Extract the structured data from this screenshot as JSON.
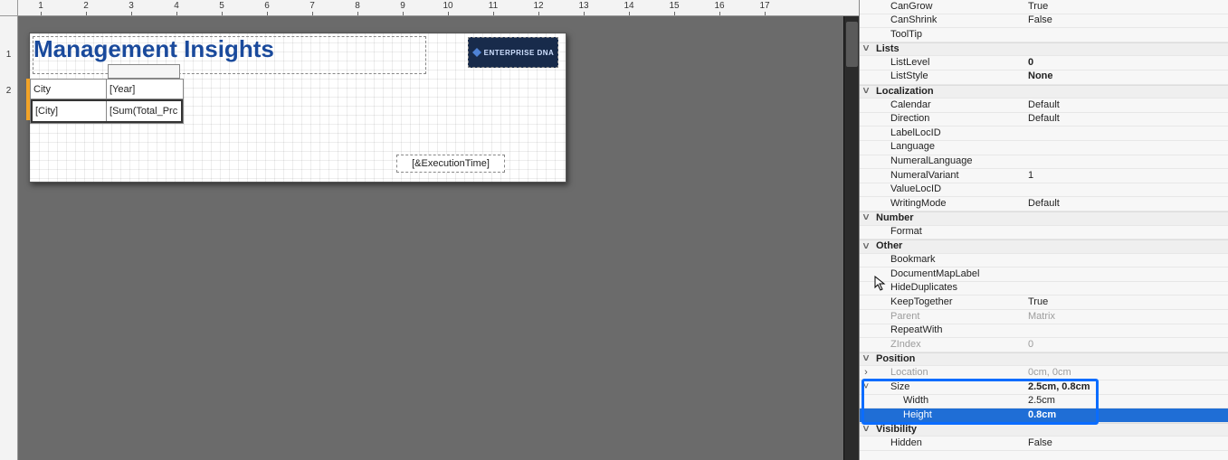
{
  "ruler_top": [
    "1",
    "2",
    "3",
    "4",
    "5",
    "6",
    "7",
    "8",
    "9",
    "10",
    "11",
    "12",
    "13",
    "14",
    "15",
    "16",
    "17"
  ],
  "ruler_left": [
    "1",
    "2"
  ],
  "report": {
    "title": "Management Insights",
    "logo_text": "ENTERPRISE DNA",
    "matrix": {
      "header_row": [
        "City",
        "[Year]"
      ],
      "data_row": [
        "[City]",
        "[Sum(Total_Prc"
      ]
    },
    "execution_time": "[&ExecutionTime]"
  },
  "properties": [
    {
      "type": "row",
      "indent": "indent",
      "key": "CanGrow",
      "value": "True"
    },
    {
      "type": "row",
      "indent": "indent",
      "key": "CanShrink",
      "value": "False"
    },
    {
      "type": "row",
      "indent": "indent",
      "key": "ToolTip",
      "value": ""
    },
    {
      "type": "header",
      "key": "Lists"
    },
    {
      "type": "row",
      "indent": "indent",
      "key": "ListLevel",
      "value": "0",
      "bold": true
    },
    {
      "type": "row",
      "indent": "indent",
      "key": "ListStyle",
      "value": "None",
      "bold": true
    },
    {
      "type": "header",
      "key": "Localization"
    },
    {
      "type": "row",
      "indent": "indent",
      "key": "Calendar",
      "value": "Default"
    },
    {
      "type": "row",
      "indent": "indent",
      "key": "Direction",
      "value": "Default"
    },
    {
      "type": "row",
      "indent": "indent",
      "key": "LabelLocID",
      "value": ""
    },
    {
      "type": "row",
      "indent": "indent",
      "key": "Language",
      "value": ""
    },
    {
      "type": "row",
      "indent": "indent",
      "key": "NumeralLanguage",
      "value": ""
    },
    {
      "type": "row",
      "indent": "indent",
      "key": "NumeralVariant",
      "value": "1"
    },
    {
      "type": "row",
      "indent": "indent",
      "key": "ValueLocID",
      "value": ""
    },
    {
      "type": "row",
      "indent": "indent",
      "key": "WritingMode",
      "value": "Default"
    },
    {
      "type": "header",
      "key": "Number"
    },
    {
      "type": "row",
      "indent": "indent",
      "key": "Format",
      "value": ""
    },
    {
      "type": "header",
      "key": "Other"
    },
    {
      "type": "row",
      "indent": "indent",
      "key": "Bookmark",
      "value": ""
    },
    {
      "type": "row",
      "indent": "indent",
      "key": "DocumentMapLabel",
      "value": ""
    },
    {
      "type": "row",
      "indent": "indent",
      "key": "HideDuplicates",
      "value": ""
    },
    {
      "type": "row",
      "indent": "indent",
      "key": "KeepTogether",
      "value": "True"
    },
    {
      "type": "row",
      "indent": "indent",
      "key": "Parent",
      "value": "Matrix",
      "dim": true
    },
    {
      "type": "row",
      "indent": "indent",
      "key": "RepeatWith",
      "value": ""
    },
    {
      "type": "row",
      "indent": "indent",
      "key": "ZIndex",
      "value": "0",
      "dim": true
    },
    {
      "type": "header",
      "key": "Position"
    },
    {
      "type": "row",
      "indent": "indent",
      "key": "Location",
      "value": "0cm, 0cm",
      "dim": true,
      "exp": ">"
    },
    {
      "type": "row",
      "indent": "indent",
      "key": "Size",
      "value": "2.5cm, 0.8cm",
      "bold": true,
      "exp": "v",
      "hl": true
    },
    {
      "type": "row",
      "indent": "indent2",
      "key": "Width",
      "value": "2.5cm",
      "hl": true
    },
    {
      "type": "row",
      "indent": "indent2",
      "key": "Height",
      "value": "0.8cm",
      "bold": true,
      "selected": true,
      "hl": true
    },
    {
      "type": "header",
      "key": "Visibility"
    },
    {
      "type": "row",
      "indent": "indent",
      "key": "Hidden",
      "value": "False"
    }
  ],
  "highlight": {
    "top_row_index": 27,
    "rows": 3
  }
}
